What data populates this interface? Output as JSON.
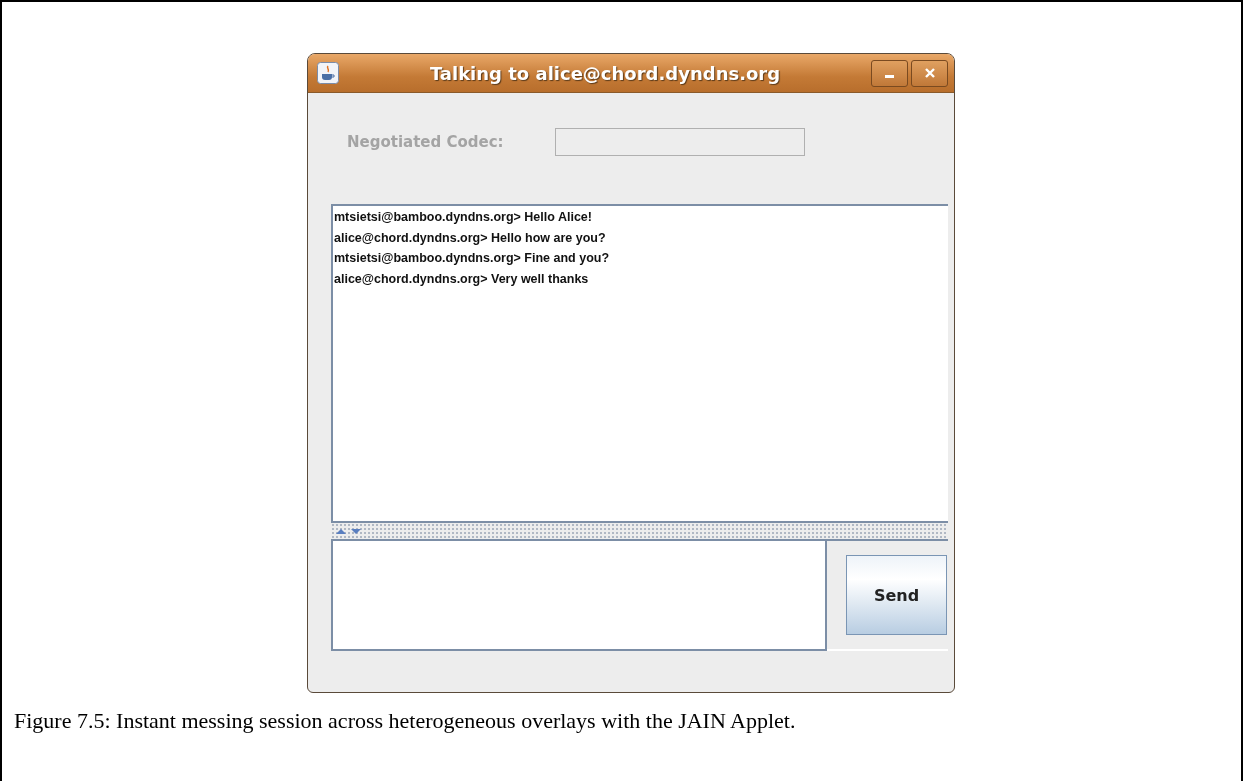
{
  "window": {
    "title": "Talking to alice@chord.dyndns.org"
  },
  "codec": {
    "label": "Negotiated Codec:",
    "disabled": true
  },
  "messages": [
    "mtsietsi@bamboo.dyndns.org> Hello Alice!",
    "alice@chord.dyndns.org> Hello how are you?",
    "mtsietsi@bamboo.dyndns.org> Fine and you?",
    "alice@chord.dyndns.org> Very well thanks"
  ],
  "send_button": {
    "label": "Send"
  },
  "caption": "Figure 7.5: Instant messing session across heterogeneous overlays with the JAIN Applet."
}
